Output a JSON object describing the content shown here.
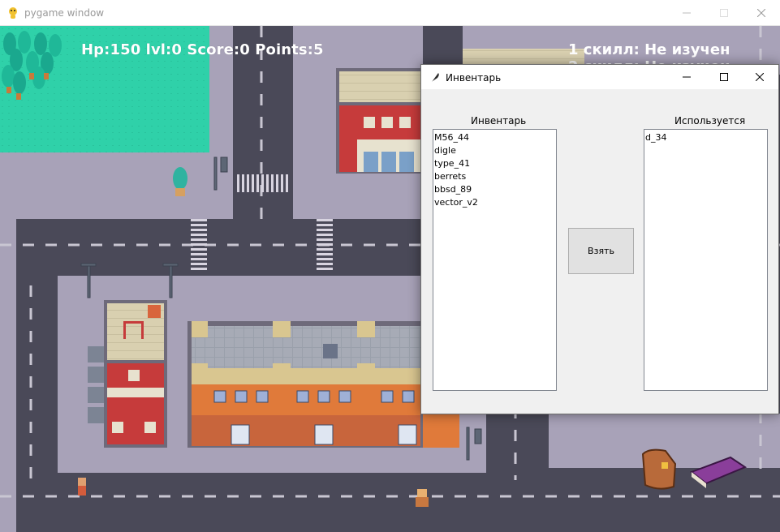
{
  "pygame_window": {
    "title": "pygame window",
    "controls": {
      "minimize": "minimize-icon",
      "maximize": "maximize-icon",
      "close": "close-icon"
    }
  },
  "hud": {
    "stats": "Hp:150 lvl:0 Score:0 Points:5",
    "skill_1": "1 скилл: Не изучен",
    "skill_2": "2 скилл: Не изучен"
  },
  "inventory_window": {
    "title": "Инвентарь",
    "left_list": {
      "label": "Инвентарь",
      "items": [
        "M56_44",
        "digle",
        "type_41",
        "berrets",
        "bbsd_89",
        "vector_v2"
      ]
    },
    "right_list": {
      "label": "Используется",
      "items": [
        "d_34"
      ]
    },
    "take_button": "Взять"
  },
  "colors": {
    "grass": "#2fd1a9",
    "road": "#4a4958",
    "sidewalk": "#a8a2b8",
    "hud_text": "#ffffff"
  }
}
